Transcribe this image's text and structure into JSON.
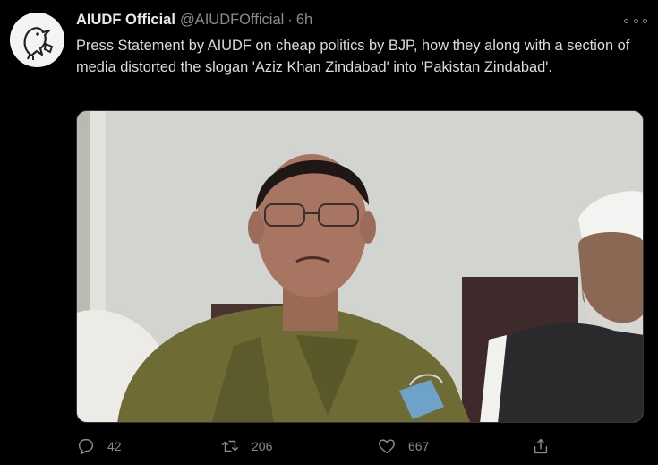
{
  "tweet": {
    "author_name": "AIUDF Official",
    "handle": "@AIUDFOfficial",
    "separator": "·",
    "time": "6h",
    "text": "Press Statement by AIUDF on cheap politics by BJP, how they along with a section of media distorted the slogan 'Aziz Khan Zindabad' into 'Pakistan Zindabad'."
  },
  "actions": {
    "reply_count": "42",
    "retweet_count": "206",
    "like_count": "667"
  },
  "icons": {
    "avatar": "aiudf-logo-icon",
    "more": "more-options-icon",
    "reply": "reply-icon",
    "retweet": "retweet-icon",
    "like": "heart-icon",
    "share": "share-icon"
  },
  "colors": {
    "background": "#000000",
    "text": "#dcdcdc",
    "muted": "#8b8b8b"
  }
}
